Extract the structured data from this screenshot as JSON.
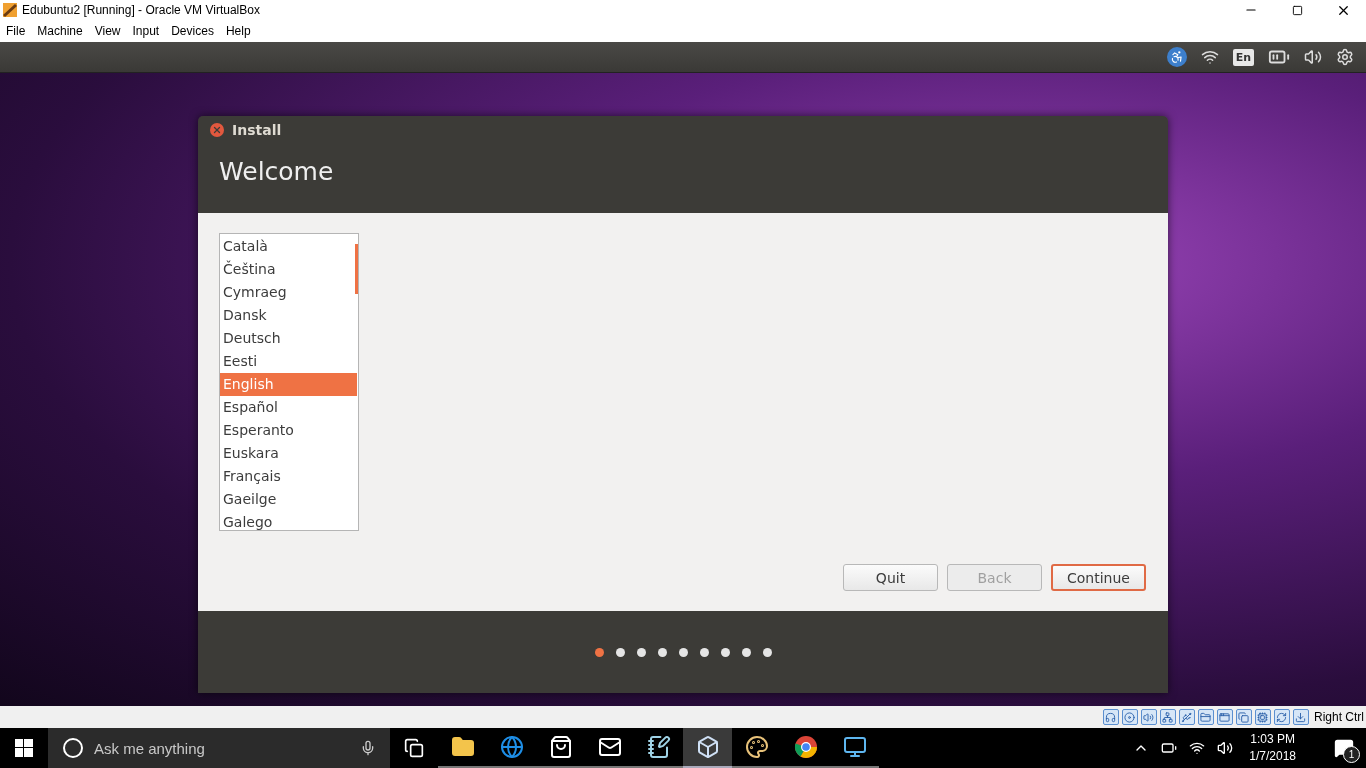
{
  "window": {
    "title": "Edubuntu2 [Running] - Oracle VM VirtualBox"
  },
  "menu": [
    "File",
    "Machine",
    "View",
    "Input",
    "Devices",
    "Help"
  ],
  "guest_panel": {
    "keyboard_layout": "En"
  },
  "installer": {
    "title": "Install",
    "heading": "Welcome",
    "languages": [
      {
        "label": "Català",
        "selected": false
      },
      {
        "label": "Čeština",
        "selected": false
      },
      {
        "label": "Cymraeg",
        "selected": false
      },
      {
        "label": "Dansk",
        "selected": false
      },
      {
        "label": "Deutsch",
        "selected": false
      },
      {
        "label": "Eesti",
        "selected": false
      },
      {
        "label": "English",
        "selected": true
      },
      {
        "label": "Español",
        "selected": false
      },
      {
        "label": "Esperanto",
        "selected": false
      },
      {
        "label": "Euskara",
        "selected": false
      },
      {
        "label": "Français",
        "selected": false
      },
      {
        "label": "Gaeilge",
        "selected": false
      },
      {
        "label": "Galego",
        "selected": false
      }
    ],
    "buttons": [
      {
        "label": "Quit",
        "kind": "normal"
      },
      {
        "label": "Back",
        "kind": "disabled"
      },
      {
        "label": "Continue",
        "kind": "default"
      }
    ],
    "steps": [
      {
        "selected": true
      },
      {
        "selected": false
      },
      {
        "selected": false
      },
      {
        "selected": false
      },
      {
        "selected": false
      },
      {
        "selected": false
      },
      {
        "selected": false
      },
      {
        "selected": false
      },
      {
        "selected": false
      }
    ]
  },
  "status_bar": {
    "host_key": "Right Ctrl"
  },
  "taskbar": {
    "search_placeholder": "Ask me anything",
    "time": "1:03 PM",
    "date": "1/7/2018",
    "notification_count": "1",
    "apps": [
      {
        "kind": "folder",
        "active": false
      },
      {
        "kind": "browser",
        "active": false
      },
      {
        "kind": "store",
        "active": false
      },
      {
        "kind": "mail",
        "active": false
      },
      {
        "kind": "notes",
        "active": false
      },
      {
        "kind": "cube",
        "active": true
      },
      {
        "kind": "palette",
        "active": false
      },
      {
        "kind": "chrome",
        "active": false
      },
      {
        "kind": "monitor",
        "active": false
      }
    ]
  }
}
